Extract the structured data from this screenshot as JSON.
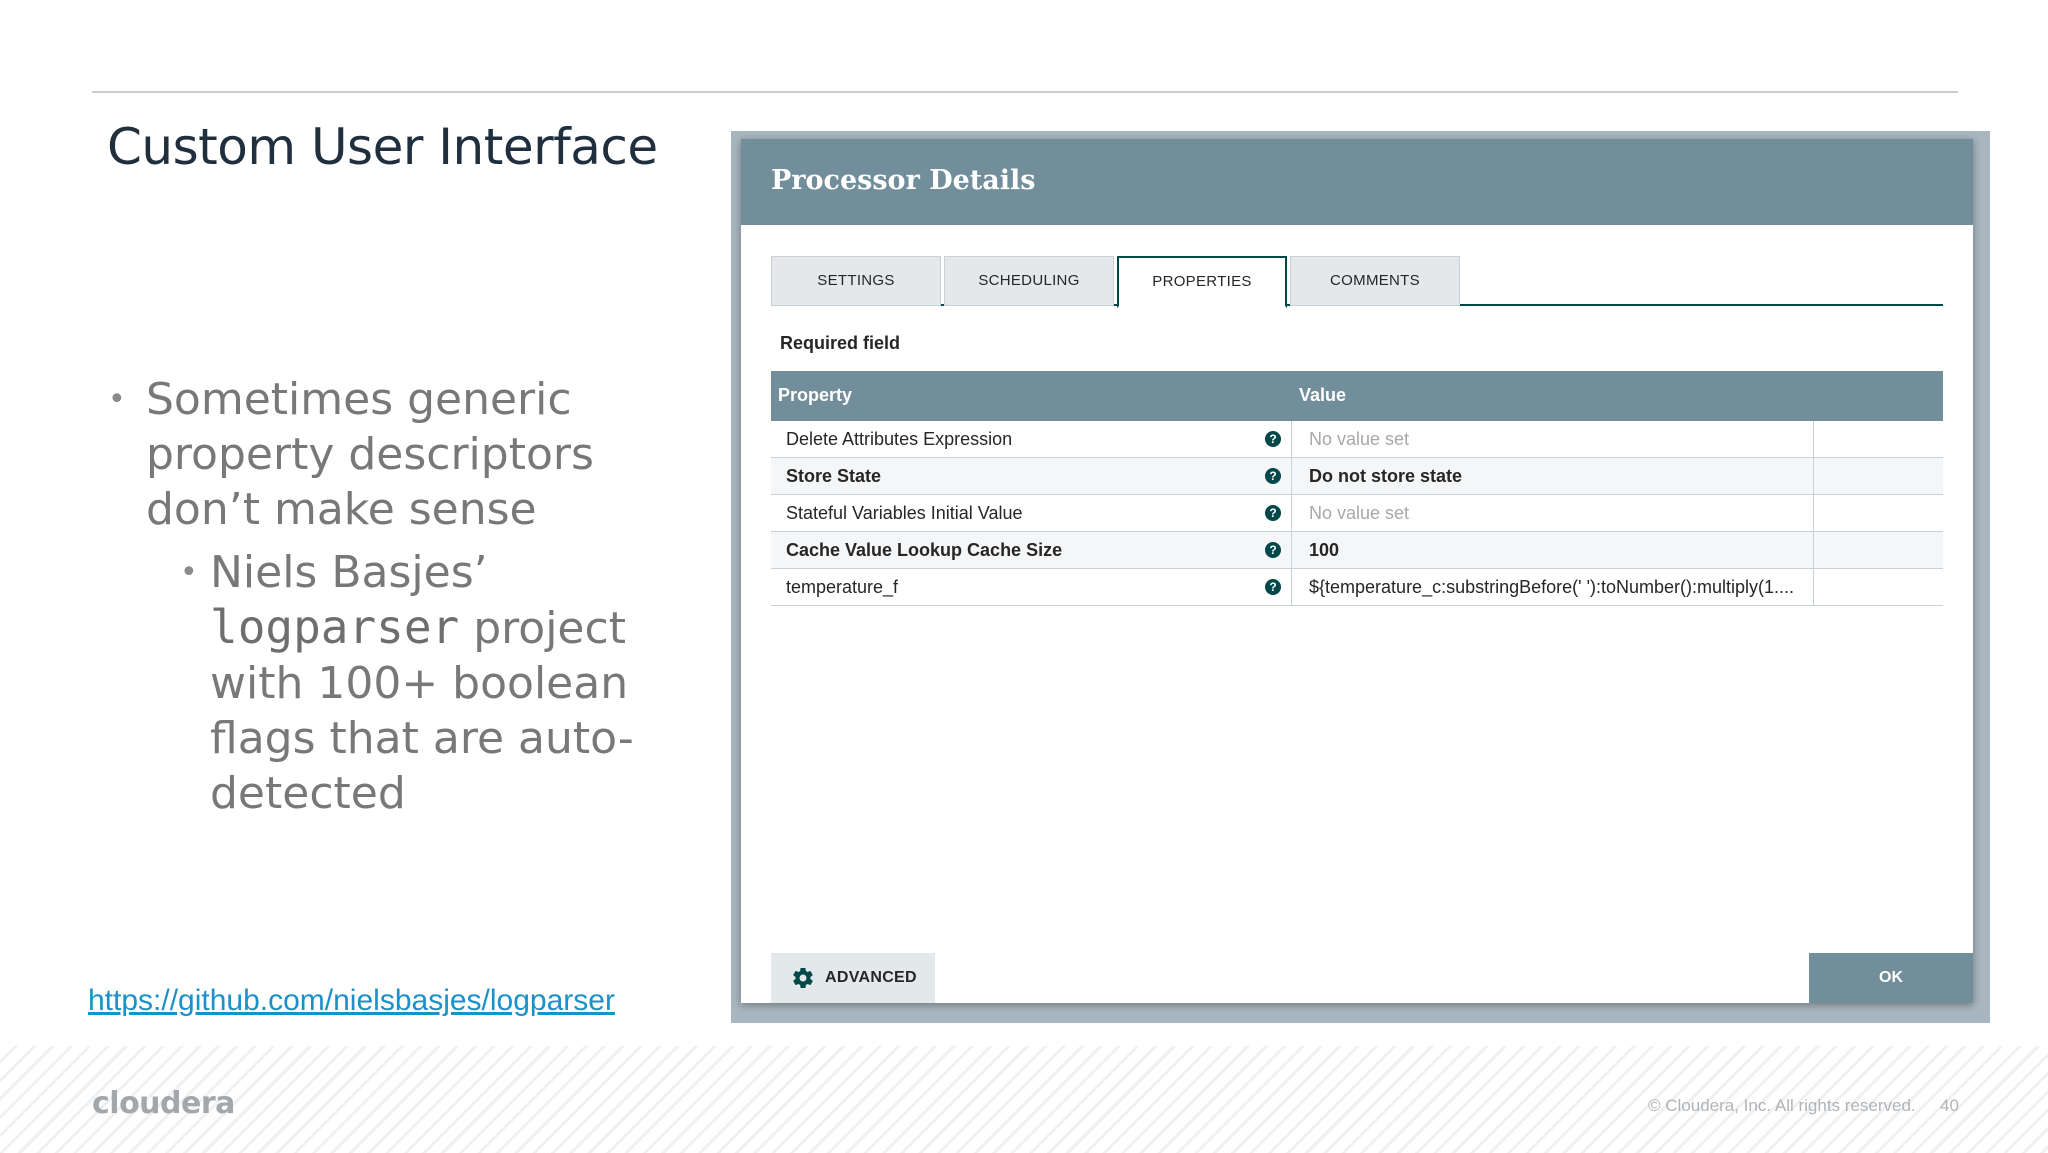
{
  "slide": {
    "title": "Custom User Interface",
    "bullet1": "Sometimes generic property descriptors don’t make sense",
    "bullet2_pre": "Niels Basjes’ ",
    "bullet2_code": "logparser",
    "bullet2_post": " project with 100+ boolean flags that are auto-detected",
    "link": "https://github.com/nielsbasjes/logparser"
  },
  "footer": {
    "logo": "cloudera",
    "copyright": "© Cloudera, Inc. All rights reserved.",
    "page": "40"
  },
  "dialog": {
    "title": "Processor Details",
    "tabs": [
      {
        "label": "SETTINGS",
        "active": false
      },
      {
        "label": "SCHEDULING",
        "active": false
      },
      {
        "label": "PROPERTIES",
        "active": true
      },
      {
        "label": "COMMENTS",
        "active": false
      }
    ],
    "required_label": "Required field",
    "table": {
      "col_property": "Property",
      "col_value": "Value",
      "rows": [
        {
          "name": "Delete Attributes Expression",
          "required": false,
          "value": "No value set",
          "empty": true
        },
        {
          "name": "Store State",
          "required": true,
          "value": "Do not store state",
          "empty": false
        },
        {
          "name": "Stateful Variables Initial Value",
          "required": false,
          "value": "No value set",
          "empty": true
        },
        {
          "name": "Cache Value Lookup Cache Size",
          "required": true,
          "value": "100",
          "empty": false
        },
        {
          "name": "temperature_f",
          "required": false,
          "value": "${temperature_c:substringBefore(' '):toNumber():multiply(1....",
          "empty": false
        }
      ]
    },
    "help_glyph": "?",
    "advanced_label": "ADVANCED",
    "ok_label": "OK",
    "icons": {
      "help": "question-circle-icon",
      "advanced": "gear-icon"
    },
    "colors": {
      "header": "#728e9b",
      "accent": "#004849",
      "link": "#1a91c9"
    }
  }
}
